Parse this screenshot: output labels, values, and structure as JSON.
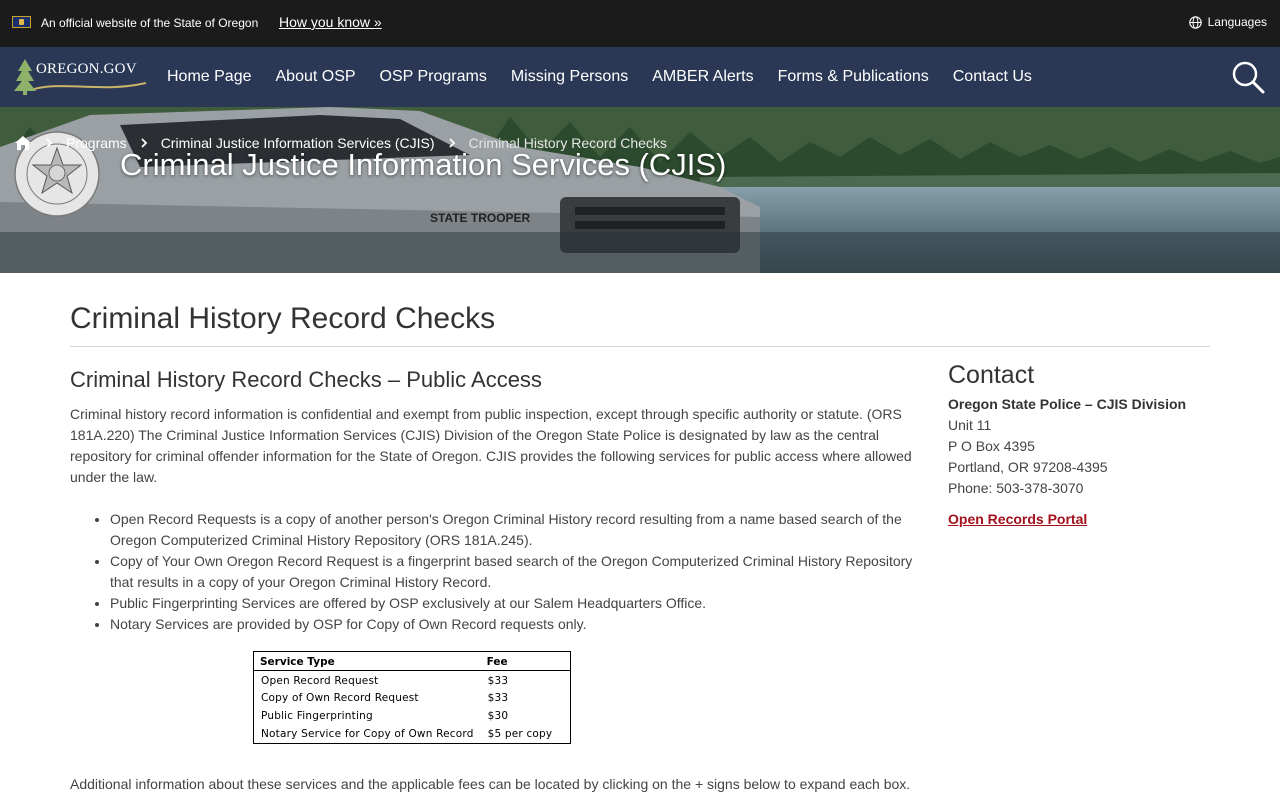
{
  "official_bar": {
    "text": "An official website of the State of Oregon",
    "how_link": "How you know »",
    "languages": "Languages"
  },
  "nav": {
    "logo_text": "OREGON.GOV",
    "items": [
      {
        "label": "Home Page"
      },
      {
        "label": "About OSP"
      },
      {
        "label": "OSP Programs"
      },
      {
        "label": "Missing Persons"
      },
      {
        "label": "AMBER Alerts"
      },
      {
        "label": "Forms & Publications"
      },
      {
        "label": "Contact Us"
      }
    ]
  },
  "hero": {
    "title": "Criminal Justice Information Services (CJIS)",
    "breadcrumb": [
      "Programs",
      "Criminal Justice Information Services (CJIS)",
      "Criminal History Record Checks"
    ]
  },
  "page": {
    "title": "Criminal History Record Checks"
  },
  "main": {
    "heading": "Criminal History Record Checks – Public Access",
    "intro": "Criminal history record information is confidential and exempt from public inspection, except through specific authority or statute.  (ORS 181A.220) The Criminal Justice Information Services (CJIS) Division of the Oregon State Police is designated by law as the central repository for criminal offender information for the State of Oregon.   CJIS provides the following services for public access where allowed under the law.",
    "services": [
      "Open Record Requests is a copy of another person's Oregon Criminal History record resulting from a name based search of the Oregon Computerized Criminal History Repository (ORS 181A.245).",
      "Copy of Your Own Oregon Record Request is a fingerprint based search of the Oregon Computerized Criminal History Repository that results in a copy of your Oregon Criminal History Record.",
      "Public Fingerprinting Services are offered by OSP exclusively at our Salem Headquarters Office.",
      "Notary Services are provided by OSP for Copy of Own Record requests only."
    ],
    "fee_table": {
      "headers": [
        "Service Type",
        "Fee"
      ],
      "rows": [
        [
          "Open Record Request",
          "$33"
        ],
        [
          "Copy of Own Record Request",
          "$33"
        ],
        [
          "Public Fingerprinting",
          "$30"
        ],
        [
          "Notary Service for Copy of Own Record",
          "$5 per copy"
        ]
      ]
    },
    "additional": "Additional information about these services and the applicable fees can be located by clicking on the + signs below to expand each box."
  },
  "contact": {
    "heading": "Contact",
    "org": "Oregon State Police – CJIS Division",
    "lines": [
      "Unit 11",
      "P O Box 4395",
      "Portland, OR 97208-4395",
      "Phone: 503-378-3070"
    ],
    "portal_link": "Open Records Portal"
  },
  "colors": {
    "official_bar": "#1b1b1b",
    "nav_bar": "#2a3856",
    "link_red": "#a3111c"
  }
}
